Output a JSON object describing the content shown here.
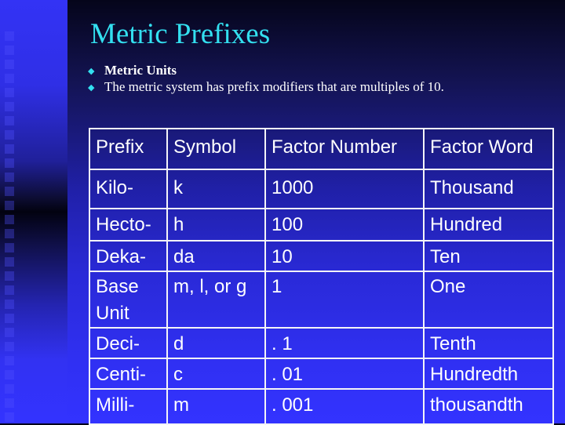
{
  "slide": {
    "title": "Metric Prefixes",
    "bullets": [
      {
        "icon": "diamond-bullet-icon",
        "text": "Metric Units",
        "bold": true
      },
      {
        "icon": "diamond-bullet-icon",
        "text": "The metric system has prefix modifiers that are multiples of 10.",
        "bold": false
      }
    ],
    "colors": {
      "title": "#33e0f0",
      "bullet": "#33e0f0",
      "text": "#ffffff",
      "table_border": "#f4f4f8"
    }
  },
  "table": {
    "headers": [
      "Prefix",
      "Symbol",
      "Factor Number",
      "Factor Word"
    ],
    "rows": [
      [
        "Kilo-",
        "k",
        "1000",
        "Thousand"
      ],
      [
        "Hecto-",
        "h",
        "100",
        "Hundred"
      ],
      [
        "Deka-",
        "da",
        "10",
        "Ten"
      ],
      [
        "Base Unit",
        "m, l, or g",
        "1",
        "One"
      ],
      [
        "Deci-",
        "d",
        ". 1",
        "Tenth"
      ],
      [
        "Centi-",
        "c",
        ". 01",
        "Hundredth"
      ],
      [
        "Milli-",
        "m",
        ". 001",
        "thousandth"
      ]
    ]
  }
}
